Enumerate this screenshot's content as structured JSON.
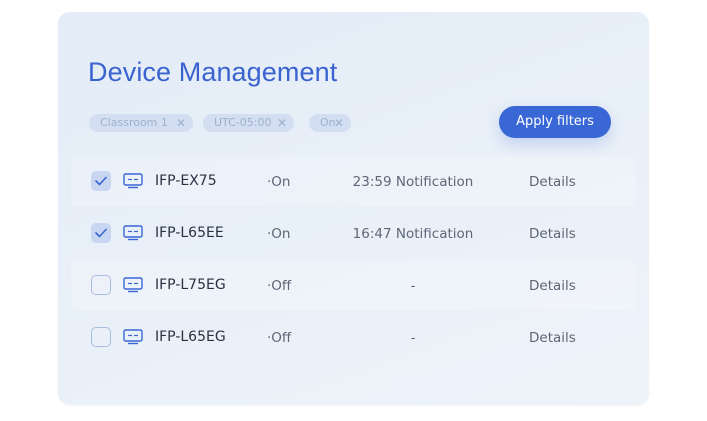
{
  "header": {
    "title": "Device Management"
  },
  "filters": {
    "chips": [
      {
        "label": "Classroom 1",
        "remove": "✕"
      },
      {
        "label": "UTC-05:00",
        "remove": "✕"
      },
      {
        "label": "On",
        "remove": "✕"
      }
    ],
    "apply_label": "Apply filters"
  },
  "devices": [
    {
      "checked": true,
      "name": "IFP-EX75",
      "status": "·On",
      "notification": "23:59 Notification",
      "details": "Details"
    },
    {
      "checked": true,
      "name": "IFP-L65EE",
      "status": "·On",
      "notification": "16:47 Notification",
      "details": "Details"
    },
    {
      "checked": false,
      "name": "IFP-L75EG",
      "status": "·Off",
      "notification": "-",
      "details": "Details"
    },
    {
      "checked": false,
      "name": "IFP-L65EG",
      "status": "·Off",
      "notification": "-",
      "details": "Details"
    }
  ],
  "colors": {
    "accent": "#3a67d6",
    "title": "#3b63d0",
    "chip_bg": "#d3def2",
    "chip_text": "#9fb0cc",
    "card_bg": "#e6eef8"
  },
  "icons": {
    "device": "monitor-icon",
    "check": "checkmark-icon",
    "remove": "close-icon"
  }
}
